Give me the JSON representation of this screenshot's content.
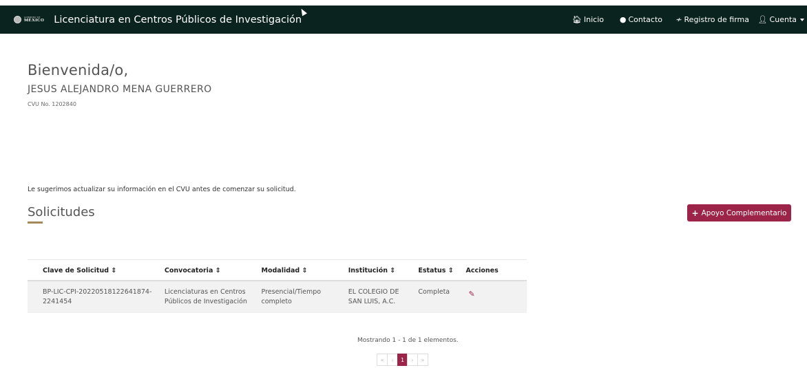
{
  "header": {
    "logo_small": "GOBIERNO DE",
    "logo_big": "MÉXICO",
    "title": "Licenciatura en Centros Públicos de Investigación",
    "nav": [
      {
        "label": "Inicio",
        "icon": "home-icon"
      },
      {
        "label": "Contacto",
        "icon": "chat-icon"
      },
      {
        "label": "Registro de firma",
        "icon": "signature-icon"
      },
      {
        "label": "Cuenta",
        "icon": "user-icon"
      }
    ],
    "background": "#0b231e"
  },
  "welcome": {
    "title": "Bienvenida/o,",
    "name": "JESUS ALEJANDRO MENA GUERRERO",
    "cvu": "CVU No. 1202840"
  },
  "suggestion": "Le sugerimos actualizar su información en el CVU antes de comenzar su solicitud.",
  "section": {
    "title": "Solicitudes",
    "button_label": "Apoyo Complementario",
    "accent": "#9d2449",
    "underline_color": "#a5885a"
  },
  "table": {
    "headers": [
      "Clave de Solicitud",
      "Convocatoria",
      "Modalidad",
      "Institución",
      "Estatus",
      "Acciones"
    ],
    "rows": [
      {
        "clave": "BP-LIC-CPI-20220518122641874-2241454",
        "convocatoria": "Licenciaturas en Centros Públicos de Investigación",
        "modalidad": "Presencial/Tiempo completo",
        "institucion": "EL COLEGIO DE SAN LUIS, A.C.",
        "estatus": "Completa"
      }
    ]
  },
  "footer": {
    "showing": "Mostrando 1 - 1 de 1 elementos.",
    "pages": [
      "«",
      "‹",
      "1",
      "›",
      "»"
    ]
  }
}
